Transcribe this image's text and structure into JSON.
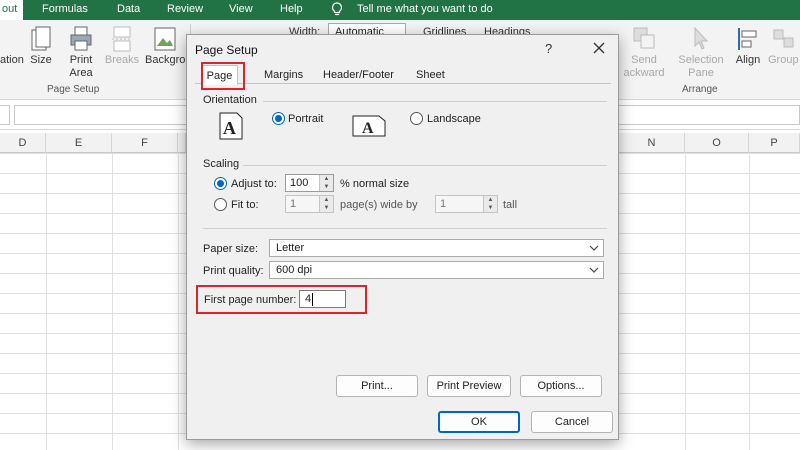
{
  "ribbon_tabs": [
    "out",
    "Formulas",
    "Data",
    "Review",
    "View",
    "Help"
  ],
  "tell_me": "Tell me what you want to do",
  "ribbon": {
    "orientation_label": "ation",
    "size_label": "Size",
    "print_area_label": [
      "Print",
      "Area"
    ],
    "breaks_label": "Breaks",
    "background_label": "Backgro",
    "page_setup_group": "Page Setup",
    "width_label": "Width:",
    "width_value": "Automatic",
    "gridlines_label": "Gridlines",
    "headings_label": "Headings",
    "send_backward_label": [
      "Send",
      "ackward"
    ],
    "selection_pane_label": [
      "Selection",
      "Pane"
    ],
    "align_label": "Align",
    "group_label": "Group",
    "arrange_group": "Arrange"
  },
  "columns": [
    "D",
    "E",
    "F",
    "N",
    "O",
    "P"
  ],
  "dialog": {
    "title": "Page Setup",
    "help": "?",
    "tabs": [
      "Page",
      "Margins",
      "Header/Footer",
      "Sheet"
    ],
    "orientation": {
      "section": "Orientation",
      "portrait": "Portrait",
      "landscape": "Landscape",
      "selected": "portrait"
    },
    "scaling": {
      "section": "Scaling",
      "adjust_to": "Adjust to:",
      "adjust_value": "100",
      "adjust_suffix": "% normal size",
      "fit_to": "Fit to:",
      "fit_wide_value": "1",
      "fit_wide_suffix": "page(s) wide by",
      "fit_tall_value": "1",
      "fit_tall_suffix": "tall",
      "selected": "adjust"
    },
    "paper_size_label": "Paper size:",
    "paper_size_value": "Letter",
    "print_quality_label": "Print quality:",
    "print_quality_value": "600 dpi",
    "first_page_label": "First page number:",
    "first_page_value": "4",
    "print_button": "Print...",
    "print_preview_button": "Print Preview",
    "options_button": "Options...",
    "ok_button": "OK",
    "cancel_button": "Cancel"
  },
  "colors": {
    "excel_green": "#217346",
    "highlight_red": "#d9262c",
    "radio_blue": "#0067c0"
  }
}
